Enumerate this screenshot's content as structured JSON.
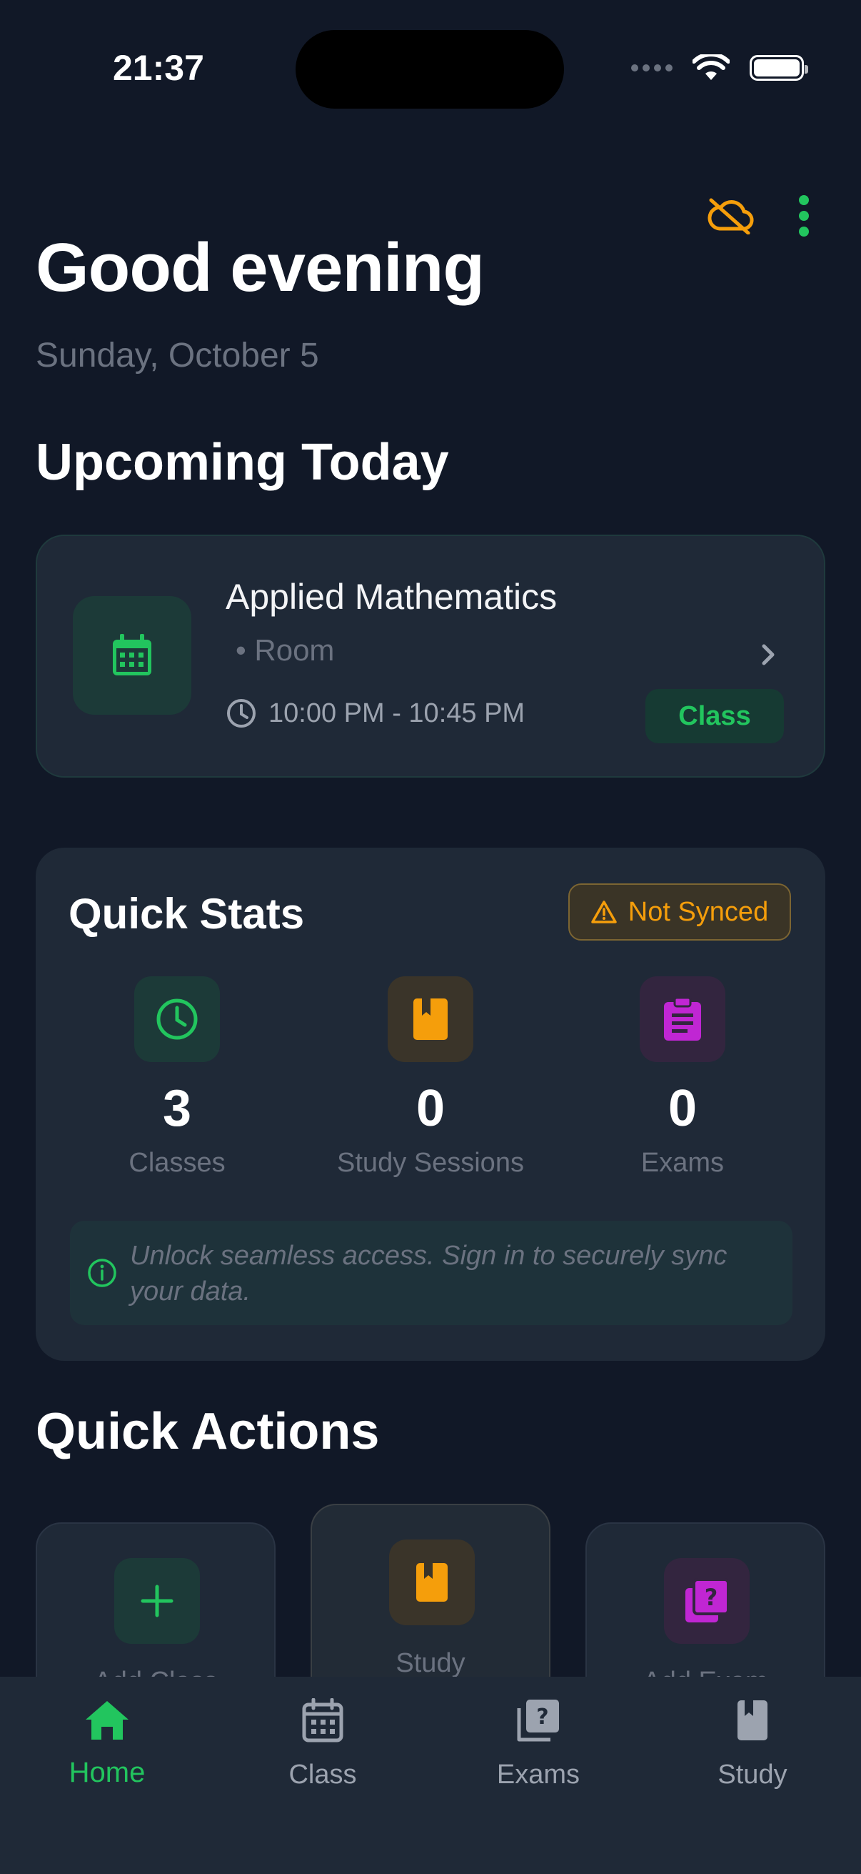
{
  "status_bar": {
    "time": "21:37"
  },
  "header": {
    "greeting": "Good evening",
    "date": "Sunday, October 5"
  },
  "upcoming": {
    "section_title": "Upcoming Today",
    "card": {
      "title": "Applied Mathematics",
      "room": "• Room",
      "time": "10:00 PM - 10:45 PM",
      "badge": "Class"
    }
  },
  "stats": {
    "title": "Quick Stats",
    "sync_status": "Not Synced",
    "items": [
      {
        "value": "3",
        "label": "Classes",
        "icon": "clock-icon",
        "color": "#22c55e"
      },
      {
        "value": "0",
        "label": "Study Sessions",
        "icon": "book-icon",
        "color": "#f59e0b"
      },
      {
        "value": "0",
        "label": "Exams",
        "icon": "clipboard-icon",
        "color": "#c026d3"
      }
    ],
    "info": "Unlock seamless access. Sign in to securely sync your data."
  },
  "actions": {
    "section_title": "Quick Actions",
    "items": [
      {
        "label": "Add Class",
        "icon": "plus-icon"
      },
      {
        "label": "Study",
        "icon": "book-icon"
      },
      {
        "label": "Add Exam",
        "icon": "quiz-icon"
      }
    ]
  },
  "tabbar": {
    "items": [
      {
        "label": "Home",
        "icon": "home-icon",
        "active": true
      },
      {
        "label": "Class",
        "icon": "calendar-icon"
      },
      {
        "label": "Exams",
        "icon": "quiz-icon"
      },
      {
        "label": "Study",
        "icon": "book-icon"
      }
    ]
  },
  "colors": {
    "background": "#111827",
    "card": "#1f2937",
    "accent_green": "#22c55e",
    "accent_orange": "#f59e0b",
    "accent_purple": "#c026d3"
  }
}
